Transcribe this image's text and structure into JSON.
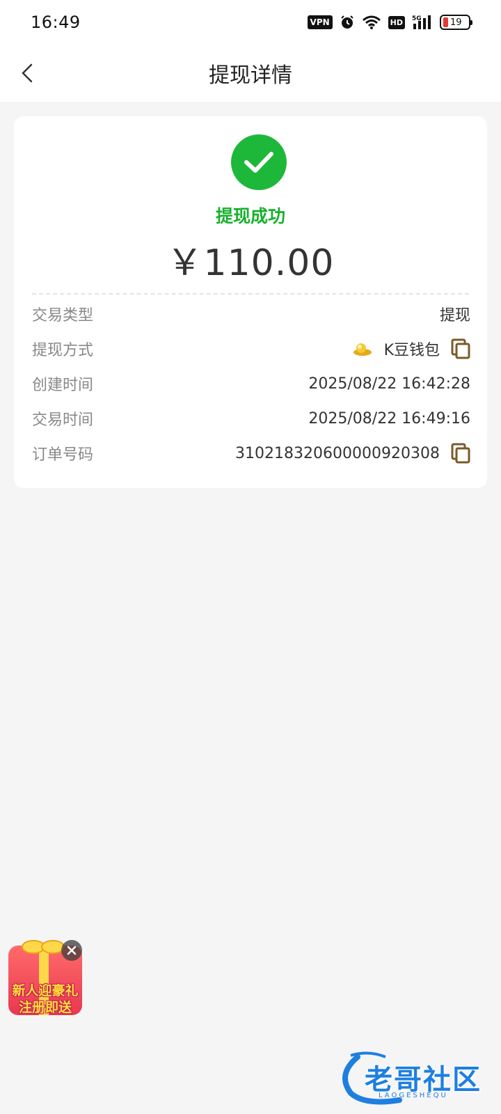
{
  "status_bar": {
    "time": "16:49",
    "vpn": "VPN",
    "hd": "HD",
    "network": "5G",
    "battery": "19"
  },
  "header": {
    "title": "提现详情"
  },
  "result": {
    "status_text": "提现成功",
    "amount": "￥110.00",
    "status_color": "#18b02e"
  },
  "details": [
    {
      "label": "交易类型",
      "value": "提现"
    },
    {
      "label": "提现方式",
      "value": "K豆钱包"
    },
    {
      "label": "创建时间",
      "value": "2025/08/22 16:42:28"
    },
    {
      "label": "交易时间",
      "value": "2025/08/22 16:49:16"
    },
    {
      "label": "订单号码",
      "value": "310218320600000920308"
    }
  ],
  "promo": {
    "line1": "新人迎豪礼",
    "line2": "注册即送"
  },
  "watermark": {
    "text": "老哥社区",
    "sub": "LAOGESHEQU"
  }
}
